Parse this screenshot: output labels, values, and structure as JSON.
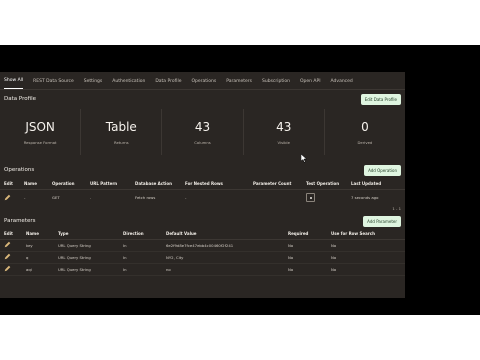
{
  "nav": {
    "tabs": [
      "Show All",
      "REST Data Source",
      "Settings",
      "Authentication",
      "Data Profile",
      "Operations",
      "Parameters",
      "Subscription",
      "Open API",
      "Advanced"
    ],
    "active_index": 0
  },
  "data_profile": {
    "title": "Data Profile",
    "edit_button": "Edit Data Profile",
    "stats": [
      {
        "value": "JSON",
        "label": "Response Format"
      },
      {
        "value": "Table",
        "label": "Returns"
      },
      {
        "value": "43",
        "label": "Columns"
      },
      {
        "value": "43",
        "label": "Visible"
      },
      {
        "value": "0",
        "label": "Derived"
      }
    ]
  },
  "operations": {
    "title": "Operations",
    "add_button": "Add Operation",
    "columns": [
      "Edit",
      "Name",
      "Operation",
      "URL Pattern",
      "Database Action",
      "For Nested Rows",
      "Parameter Count",
      "Test Operation",
      "Last Updated"
    ],
    "rows": [
      {
        "name": "-",
        "operation": "GET",
        "url_pattern": ".",
        "database_action": "Fetch rows",
        "nested_rows": "-",
        "parameter_count": "",
        "last_updated": "7 seconds ago"
      }
    ],
    "pagination": "1 - 1"
  },
  "parameters": {
    "title": "Parameters",
    "add_button": "Add Parameter",
    "columns": [
      "Edit",
      "Name",
      "Type",
      "Direction",
      "Default Value",
      "Required",
      "Use for Row Search"
    ],
    "rows": [
      {
        "name": "key",
        "type": "URL Query String",
        "direction": "In",
        "default_value": "6e2f9d8e7fce47ebb4c00460f2f241",
        "required": "No",
        "row_search": "No"
      },
      {
        "name": "q",
        "type": "URL Query String",
        "direction": "In",
        "default_value": "NY2, City",
        "required": "No",
        "row_search": "No"
      },
      {
        "name": "aqi",
        "type": "URL Query String",
        "direction": "In",
        "default_value": "no",
        "required": "No",
        "row_search": "No"
      }
    ]
  },
  "icons": {
    "edit": "pencil-icon",
    "test": "test-operation-icon",
    "cursor": "mouse-cursor-icon"
  },
  "colors": {
    "background": "#2a2623",
    "button": "#dff5e0",
    "pencil": "#d9b77a"
  }
}
